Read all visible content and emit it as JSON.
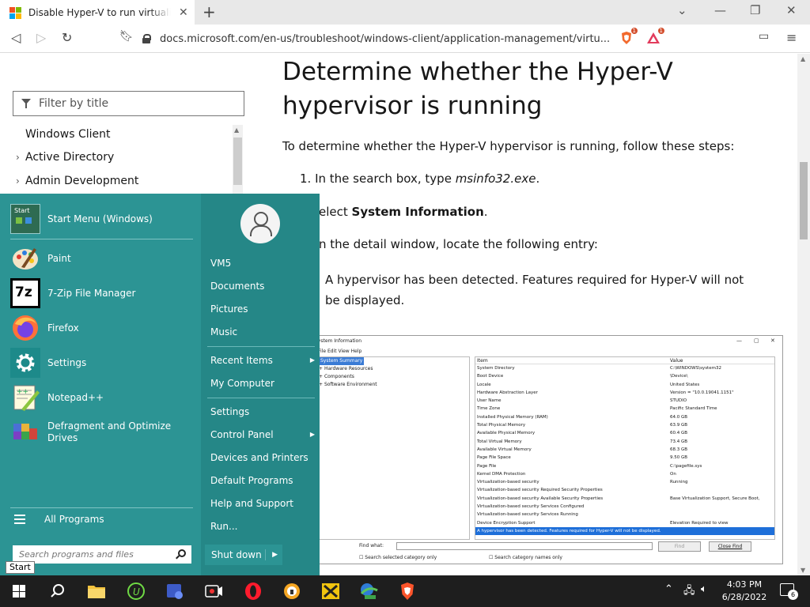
{
  "browser": {
    "tab_title": "Disable Hyper-V to run virtualizat",
    "tab_close": "✕",
    "new_tab": "+",
    "url": "docs.microsoft.com/en-us/troubleshoot/windows-client/application-management/virtu...",
    "brave_badge": "1",
    "rewards_badge": "1"
  },
  "sidebar": {
    "filter_placeholder": "Filter by title",
    "items": [
      {
        "label": "Windows Client",
        "expandable": false
      },
      {
        "label": "Active Directory",
        "expandable": true
      },
      {
        "label": "Admin Development",
        "expandable": true
      }
    ]
  },
  "article": {
    "title": "Determine whether the Hyper-V hypervisor is running",
    "intro": "To determine whether the Hyper-V hypervisor is running, follow these steps:",
    "step1_prefix": "1. In the search box, type ",
    "step1_code": "msinfo32.exe",
    "step1_suffix": ".",
    "step2_prefix": "elect ",
    "step2_bold": "System Information",
    "step2_suffix": ".",
    "step3": "n the detail window, locate the following entry:",
    "entry": "A hypervisor has been detected. Features required for Hyper-V will not be displayed."
  },
  "sysinfo": {
    "window_title": "System Information",
    "menu": "File   Edit   View   Help",
    "tree": [
      "System Summary",
      "Hardware Resources",
      "Components",
      "Software Environment"
    ],
    "col_item": "Item",
    "col_value": "Value",
    "rows": [
      [
        "System Directory",
        "C:\\WINDOWS\\system32"
      ],
      [
        "Boot Device",
        "\\Device\\"
      ],
      [
        "Locale",
        "United States"
      ],
      [
        "Hardware Abstraction Layer",
        "Version = \"10.0.19041.1151\""
      ],
      [
        "User Name",
        "STUDIO"
      ],
      [
        "Time Zone",
        "Pacific Standard Time"
      ],
      [
        "Installed Physical Memory (RAM)",
        "64.0 GB"
      ],
      [
        "Total Physical Memory",
        "63.9 GB"
      ],
      [
        "Available Physical Memory",
        "60.4 GB"
      ],
      [
        "Total Virtual Memory",
        "73.4 GB"
      ],
      [
        "Available Virtual Memory",
        "68.3 GB"
      ],
      [
        "Page File Space",
        "9.50 GB"
      ],
      [
        "Page File",
        "C:\\pagefile.sys"
      ],
      [
        "Kernel DMA Protection",
        "On"
      ],
      [
        "Virtualization-based security",
        "Running"
      ],
      [
        "Virtualization-based security Required Security Properties",
        ""
      ],
      [
        "Virtualization-based security Available Security Properties",
        "Base Virtualization Support, Secure Boot,"
      ],
      [
        "Virtualization-based security Services Configured",
        ""
      ],
      [
        "Virtualization-based security Services Running",
        ""
      ],
      [
        "Device Encryption Support",
        "Elevation Required to view"
      ]
    ],
    "highlight_row": "A hypervisor has been detected. Features required for Hyper-V will not be displayed.",
    "find_label": "Find what:",
    "find_button": "Find",
    "close_find_button": "Close Find",
    "chk1": "Search selected category only",
    "chk2": "Search category names only"
  },
  "start_menu": {
    "apps": [
      {
        "label": "Start Menu (Windows)",
        "icon": "start-menu-icon"
      },
      {
        "label": "Paint",
        "icon": "paint-icon"
      },
      {
        "label": "7-Zip File Manager",
        "icon": "7zip-icon"
      },
      {
        "label": "Firefox",
        "icon": "firefox-icon"
      },
      {
        "label": "Settings",
        "icon": "settings-gear-icon"
      },
      {
        "label": "Notepad++",
        "icon": "notepadpp-icon"
      },
      {
        "label": "Defragment and Optimize Drives",
        "icon": "defrag-icon"
      }
    ],
    "all_programs": "All Programs",
    "search_placeholder": "Search programs and files",
    "places": [
      "VM5",
      "Documents",
      "Pictures",
      "Music",
      "Recent Items",
      "My Computer",
      "Settings",
      "Control Panel",
      "Devices and Printers",
      "Default Programs",
      "Help and Support",
      "Run..."
    ],
    "shutdown": "Shut down",
    "tooltip": "Start",
    "startmenu_icon_text": "Start"
  },
  "taskbar": {
    "time": "4:03 PM",
    "date": "6/28/2022",
    "notification_count": "6",
    "seven_zip_label": "7z"
  },
  "colors": {
    "start_menu_bg": "#2c9494",
    "start_menu_right_bg": "#258787",
    "taskbar_bg": "#1e1e1e"
  }
}
